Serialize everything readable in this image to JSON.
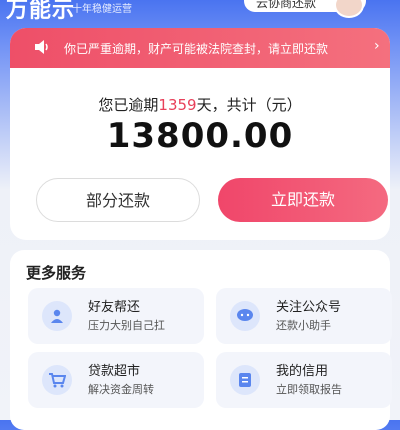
{
  "header": {
    "brand": "万能示",
    "slogan": "十年稳健运营",
    "service_label": "云协商还款"
  },
  "notice": {
    "text": "你已严重逾期，财产可能被法院查封，请立即还款",
    "arrow": "›",
    "icon": "speaker-icon"
  },
  "debt": {
    "overdue_prefix": "您已逾期",
    "overdue_days": "1359",
    "overdue_suffix": "天，共计（元）",
    "amount": "13800.00"
  },
  "actions": {
    "partial_label": "部分还款",
    "pay_now_label": "立即还款"
  },
  "services": {
    "title": "更多服务",
    "items": [
      {
        "title": "好友帮还",
        "subtitle": "压力大别自己扛",
        "icon": "user-icon"
      },
      {
        "title": "关注公众号",
        "subtitle": "还款小助手",
        "icon": "chat-icon"
      },
      {
        "title": "贷款超市",
        "subtitle": "解决资金周转",
        "icon": "cart-icon"
      },
      {
        "title": "我的信用",
        "subtitle": "立即领取报告",
        "icon": "document-icon"
      }
    ]
  },
  "colors": {
    "accent_red": "#ee4f68",
    "brand_blue": "#4a74f0"
  }
}
